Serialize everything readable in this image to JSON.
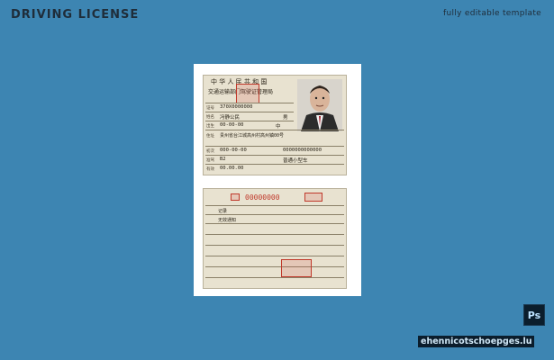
{
  "header": {
    "title": "DRIVING LICENSE",
    "subtitle": "fully editable template"
  },
  "front": {
    "country": "中 华 人 民 共 和 国",
    "authority": "交通运输部门驾驶证管理局",
    "number": "370X0000000",
    "name": "冯静公民",
    "sex": "男",
    "dob": "00-00-00",
    "nationality": "中",
    "address": "贵州省台江城高州村高州镇00号",
    "issue_date": "000-00-00",
    "license_id": "0000000000000",
    "class": "B2",
    "valid_from": "00.00.00",
    "valid_until": "普通小型车"
  },
  "back": {
    "serial": "00000000",
    "remark": "记录",
    "note": "无效通知"
  },
  "badges": {
    "app": "Ps",
    "site": "ehennicotschoepges.lu"
  }
}
